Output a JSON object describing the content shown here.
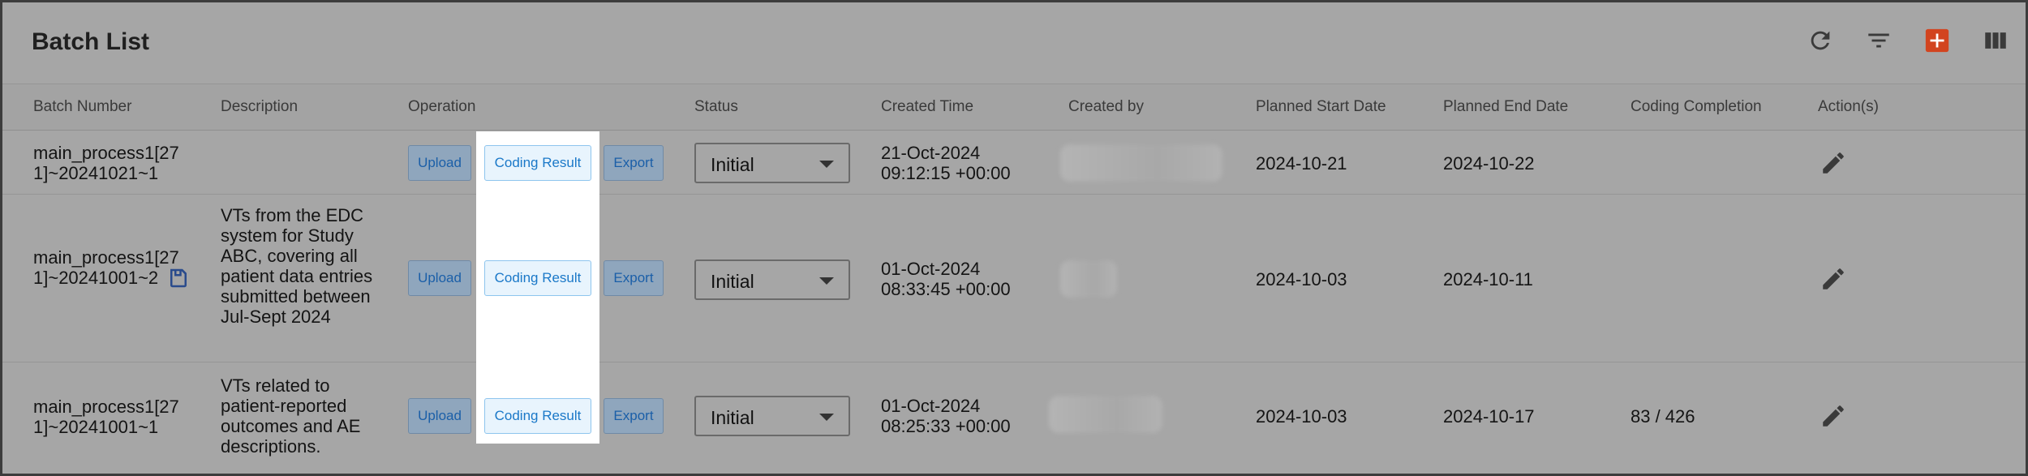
{
  "page": {
    "title": "Batch List"
  },
  "toolbar": {
    "icons": [
      "refresh-icon",
      "filter-icon",
      "add-icon",
      "columns-icon"
    ],
    "accent": "#d2441f"
  },
  "table": {
    "headers": [
      "Batch Number",
      "Description",
      "Operation",
      "Status",
      "Created Time",
      "Created by",
      "Planned Start Date",
      "Planned End Date",
      "Coding Completion",
      "Action(s)"
    ],
    "buttons": {
      "upload": "Upload",
      "coding": "Coding Result",
      "export": "Export"
    },
    "rows": [
      {
        "batch_number": "main_process1[271]~20241021~1",
        "description": "",
        "status": "Initial",
        "created_time_1": "21-Oct-2024",
        "created_time_2": "09:12:15 +00:00",
        "created_by": "",
        "planned_start": "2024-10-21",
        "planned_end": "2024-10-22",
        "coding_completion": ""
      },
      {
        "batch_number": "main_process1[271]~20241001~2",
        "description": "VTs from the EDC system for Study ABC, covering all patient data entries submitted between Jul-Sept 2024",
        "status": "Initial",
        "created_time_1": "01-Oct-2024",
        "created_time_2": "08:33:45 +00:00",
        "created_by": "",
        "planned_start": "2024-10-03",
        "planned_end": "2024-10-11",
        "coding_completion": ""
      },
      {
        "batch_number": "main_process1[271]~20241001~1",
        "description": "VTs related to patient-reported outcomes and AE descriptions.",
        "status": "Initial",
        "created_time_1": "01-Oct-2024",
        "created_time_2": "08:25:33 +00:00",
        "created_by": "",
        "planned_start": "2024-10-03",
        "planned_end": "2024-10-17",
        "coding_completion": "83 / 426"
      }
    ]
  }
}
